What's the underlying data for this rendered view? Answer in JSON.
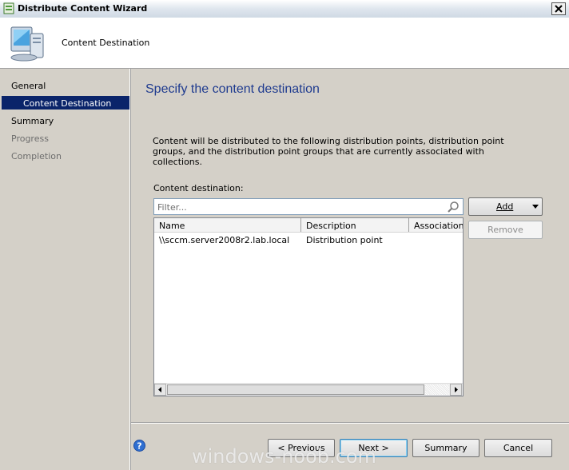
{
  "window": {
    "title": "Distribute Content Wizard",
    "header_text": "Content Destination"
  },
  "nav": {
    "items": [
      {
        "label": "General",
        "state": "normal"
      },
      {
        "label": "Content Destination",
        "state": "selected"
      },
      {
        "label": "Summary",
        "state": "normal"
      },
      {
        "label": "Progress",
        "state": "disabled"
      },
      {
        "label": "Completion",
        "state": "disabled"
      }
    ]
  },
  "main": {
    "title": "Specify the content destination",
    "description": "Content will be distributed to the following distribution points, distribution point groups, and the distribution point groups that are currently associated with collections.",
    "content_destination_label": "Content destination:",
    "filter_placeholder": "Filter...",
    "columns": [
      "Name",
      "Description",
      "Associations"
    ],
    "rows": [
      {
        "name": "\\\\sccm.server2008r2.lab.local",
        "description": "Distribution point",
        "associations": ""
      }
    ],
    "add_label": "Add",
    "remove_label": "Remove"
  },
  "footer": {
    "previous_label": "< Previous",
    "next_label": "Next >",
    "summary_label": "Summary",
    "cancel_label": "Cancel"
  },
  "watermark": "windows-noob.com",
  "colors": {
    "title_blue": "#1f3b8f",
    "selection": "#0a246a",
    "window_bg": "#d4d0c8"
  }
}
